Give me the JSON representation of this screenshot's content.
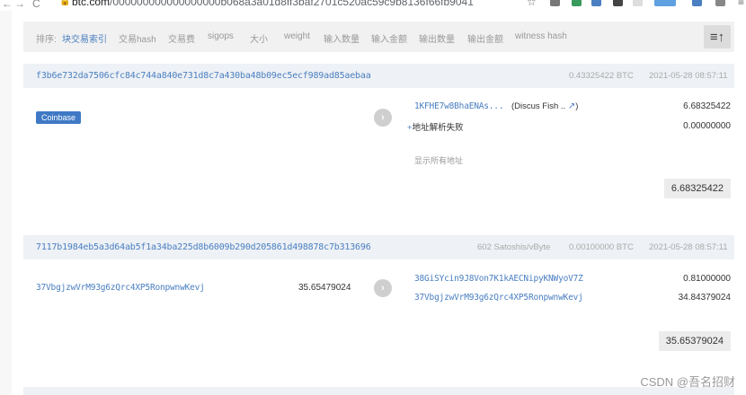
{
  "browser": {
    "back": "←",
    "forward": "→",
    "reload": "C",
    "url_host": "btc.com",
    "url_path": "/000000000000000000b068a3a01d8ff3baf2701c520ac59c9b8136f66fb9041",
    "star": "☆",
    "menu": "≡"
  },
  "filter_bar": {
    "label": "排序:",
    "items": [
      "块交易索引",
      "交易hash",
      "交易费",
      "sigops",
      "大小",
      "weight",
      "输入数量",
      "输入金额",
      "输出数量",
      "输出金额",
      "witness hash"
    ],
    "active_index": 0,
    "sort_icon": "≡↑"
  },
  "transactions": [
    {
      "hash": "f3b6e732da7506cfc84c744a840e731d8c7a430ba48b09ec5ecf989ad85aebaa",
      "fee_rate": "",
      "amount": "0.43325422 BTC",
      "time": "2021-05-28 08:57:11",
      "input_badge": "Coinbase",
      "outputs": [
        {
          "address": "1KFHE7w8BhaENAs...",
          "tag": "(Discus Fish ..",
          "tag_close": ")",
          "value": "6.68325422"
        },
        {
          "plus": "+",
          "address": "地址解析失败",
          "value": "0.00000000"
        }
      ],
      "show_all": "显示所有地址",
      "total": "6.68325422"
    },
    {
      "hash": "7117b1984eb5a3d64ab5f1a34ba225d8b6009b290d205861d498878c7b313696",
      "fee_rate": "602 Satoshis/vByte",
      "amount": "0.00100000 BTC",
      "time": "2021-05-28 08:57:11",
      "inputs": [
        {
          "address": "37VbgjzwVrM93g6zQrc4XP5RonpwnwKevj",
          "value": "35.65479024"
        }
      ],
      "outputs": [
        {
          "address": "38GiSYcin9J8Von7K1kAECNipyKNWyoV7Z",
          "value": "0.81000000"
        },
        {
          "address": "37VbgjzwVrM93g6zQrc4XP5RonpwnwKevj",
          "value": "34.84379024"
        }
      ],
      "total": "35.65379024"
    }
  ],
  "watermark": "CSDN @吾名招财",
  "colors": {
    "link": "#4a7fc1",
    "badge": "#3f79c5",
    "header_bg": "#eef1f5"
  }
}
